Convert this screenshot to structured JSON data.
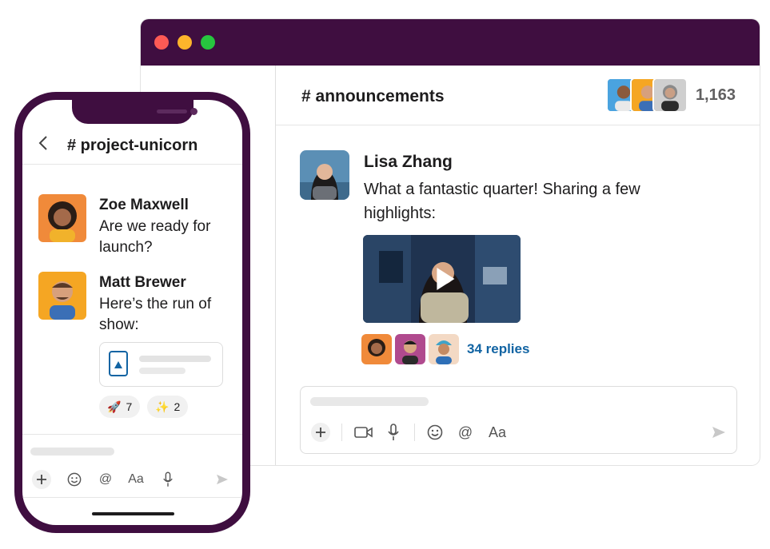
{
  "desktop": {
    "channel": "# announcements",
    "member_count": "1,163",
    "message": {
      "author": "Lisa Zhang",
      "text": "What a fantastic quarter! Sharing a few highlights:",
      "replies_label": "34 replies"
    },
    "composer_tools": [
      "plus-icon",
      "video-icon",
      "mic-icon",
      "emoji-icon",
      "mention-icon",
      "format-icon",
      "send-icon"
    ],
    "format_label": "Aa"
  },
  "phone": {
    "back": "<",
    "channel": "# project-unicorn",
    "messages": [
      {
        "author": "Zoe Maxwell",
        "text": "Are we ready for launch?"
      },
      {
        "author": "Matt Brewer",
        "text": "Here’s the run of show:"
      }
    ],
    "reactions": [
      {
        "emoji": "🚀",
        "count": "7"
      },
      {
        "emoji": "✨",
        "count": "2"
      }
    ],
    "format_label": "Aa"
  },
  "colors": {
    "aubergine": "#3f0e40",
    "link_blue": "#1264a3",
    "traffic_red": "#fd5a55",
    "traffic_yellow": "#fdb42b",
    "traffic_green": "#27c53f"
  }
}
